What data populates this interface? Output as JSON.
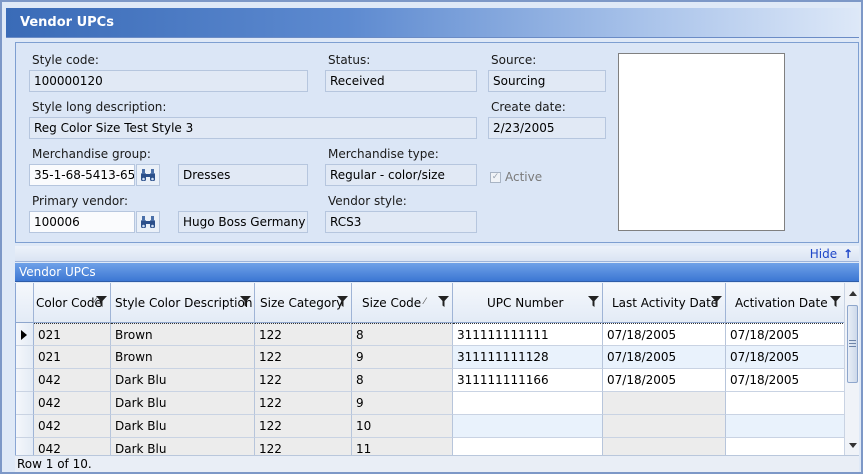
{
  "window": {
    "title": "Vendor UPCs"
  },
  "form": {
    "style_code": {
      "label": "Style code:",
      "value": "100000120"
    },
    "status": {
      "label": "Status:",
      "value": "Received"
    },
    "source": {
      "label": "Source:",
      "value": "Sourcing"
    },
    "style_long_description": {
      "label": "Style long description:",
      "value": "Reg Color Size Test Style 3"
    },
    "create_date": {
      "label": "Create date:",
      "value": "2/23/2005"
    },
    "merchandise_group": {
      "label": "Merchandise group:",
      "value": "35-1-68-5413-65",
      "description": "Dresses"
    },
    "merchandise_type": {
      "label": "Merchandise type:",
      "value": "Regular - color/size"
    },
    "active": {
      "label": "Active",
      "checked": true
    },
    "primary_vendor": {
      "label": "Primary vendor:",
      "value": "100006",
      "description": "Hugo Boss Germany"
    },
    "vendor_style": {
      "label": "Vendor style:",
      "value": "RCS3"
    },
    "hide_label": "Hide"
  },
  "grid": {
    "title": "Vendor UPCs",
    "columns": [
      "Color Code",
      "Style Color Description",
      "Size Category",
      "Size Code",
      "UPC Number",
      "Last Activity Date",
      "Activation Date"
    ],
    "rows": [
      [
        "021",
        "Brown",
        "122",
        "8",
        "311111111111",
        "07/18/2005",
        "07/18/2005"
      ],
      [
        "021",
        "Brown",
        "122",
        "9",
        "311111111128",
        "07/18/2005",
        "07/18/2005"
      ],
      [
        "042",
        "Dark Blu",
        "122",
        "8",
        "311111111166",
        "07/18/2005",
        "07/18/2005"
      ],
      [
        "042",
        "Dark Blu",
        "122",
        "9",
        "",
        "",
        ""
      ],
      [
        "042",
        "Dark Blu",
        "122",
        "10",
        "",
        "",
        ""
      ],
      [
        "042",
        "Dark Blu",
        "122",
        "11",
        "",
        "",
        ""
      ]
    ],
    "status": "Row 1 of 10."
  },
  "icons": {
    "lookup": "binoculars-icon",
    "filter": "filter-icon",
    "hide": "up-arrow-icon"
  }
}
